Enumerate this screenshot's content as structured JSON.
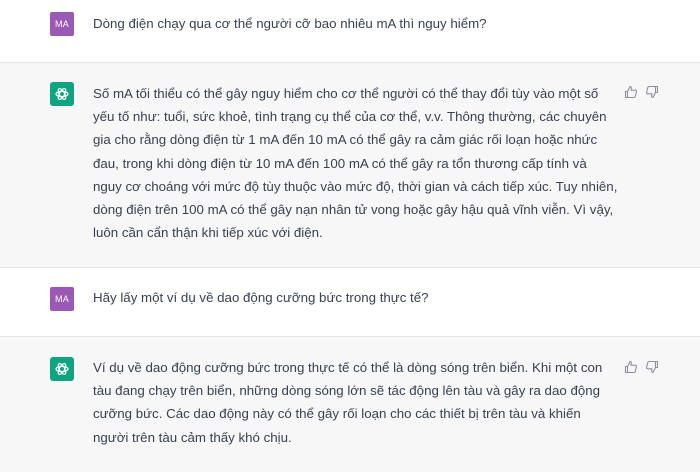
{
  "messages": [
    {
      "role": "user",
      "avatar_text": "MA",
      "text": "Dòng điện chạy qua cơ thể người cỡ bao nhiêu mA thì nguy hiểm?"
    },
    {
      "role": "assistant",
      "avatar_icon": "chatgpt-logo-icon",
      "text": "Số mA tối thiểu có thể gây nguy hiểm cho cơ thể người có thể thay đổi tùy vào một số yếu tố như: tuổi, sức khoẻ, tình trạng cụ thể của cơ thể, v.v. Thông thường, các chuyên gia cho rằng dòng điện từ 1 mA đến 10 mA có thể gây ra cảm giác rối loạn hoặc nhức đau, trong khi dòng điện từ 10 mA đến 100 mA có thể gây ra tổn thương cấp tính và nguy cơ choáng với mức độ tùy thuộc vào mức độ, thời gian và cách tiếp xúc. Tuy nhiên, dòng điện trên 100 mA có thể gây nạn nhân tử vong hoặc gây hậu quả vĩnh viễn. Vì vậy, luôn cần cẩn thận khi tiếp xúc với điện."
    },
    {
      "role": "user",
      "avatar_text": "MA",
      "text": "Hãy lấy một ví dụ về dao động cưỡng bức trong thực tế?"
    },
    {
      "role": "assistant",
      "avatar_icon": "chatgpt-logo-icon",
      "text": "Ví dụ về dao động cưỡng bức trong thực tế có thể là dòng sóng trên biển. Khi một con tàu đang chạy trên biển, những dòng sóng lớn sẽ tác động lên tàu và gây ra dao động cưỡng bức. Các dao động này có thể gây rối loạn cho các thiết bị trên tàu và khiến người trên tàu cảm thấy khó chịu."
    }
  ],
  "icons": {
    "thumbs_up": "thumbs-up-icon",
    "thumbs_down": "thumbs-down-icon"
  },
  "colors": {
    "user_avatar": "#9b59b6",
    "assistant_avatar": "#10a37f",
    "assistant_bg": "#f7f7f8",
    "text": "#374151"
  }
}
